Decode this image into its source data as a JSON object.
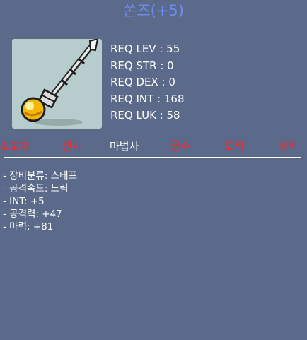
{
  "item": {
    "name": "쏜즈(+5)",
    "icon": "staff-icon",
    "colors": {
      "background": "#5b6a8a",
      "title": "#6f8cf0",
      "unavailable_job": "#ff2222",
      "available_job": "#ffffff"
    }
  },
  "requirements": [
    "REQ LEV : 55",
    "REQ STR : 0",
    "REQ DEX : 0",
    "REQ INT : 168",
    "REQ LUK : 58"
  ],
  "jobs": [
    {
      "label": "초보자",
      "available": false
    },
    {
      "label": "전사",
      "available": false
    },
    {
      "label": "마법사",
      "available": true
    },
    {
      "label": "궁수",
      "available": false
    },
    {
      "label": "도적",
      "available": false
    },
    {
      "label": "해적",
      "available": false
    }
  ],
  "stats": [
    "- 장비분류: 스태프",
    "- 공격속도: 느림",
    "- INT: +5",
    "- 공격력: +47",
    "- 마력: +81"
  ]
}
